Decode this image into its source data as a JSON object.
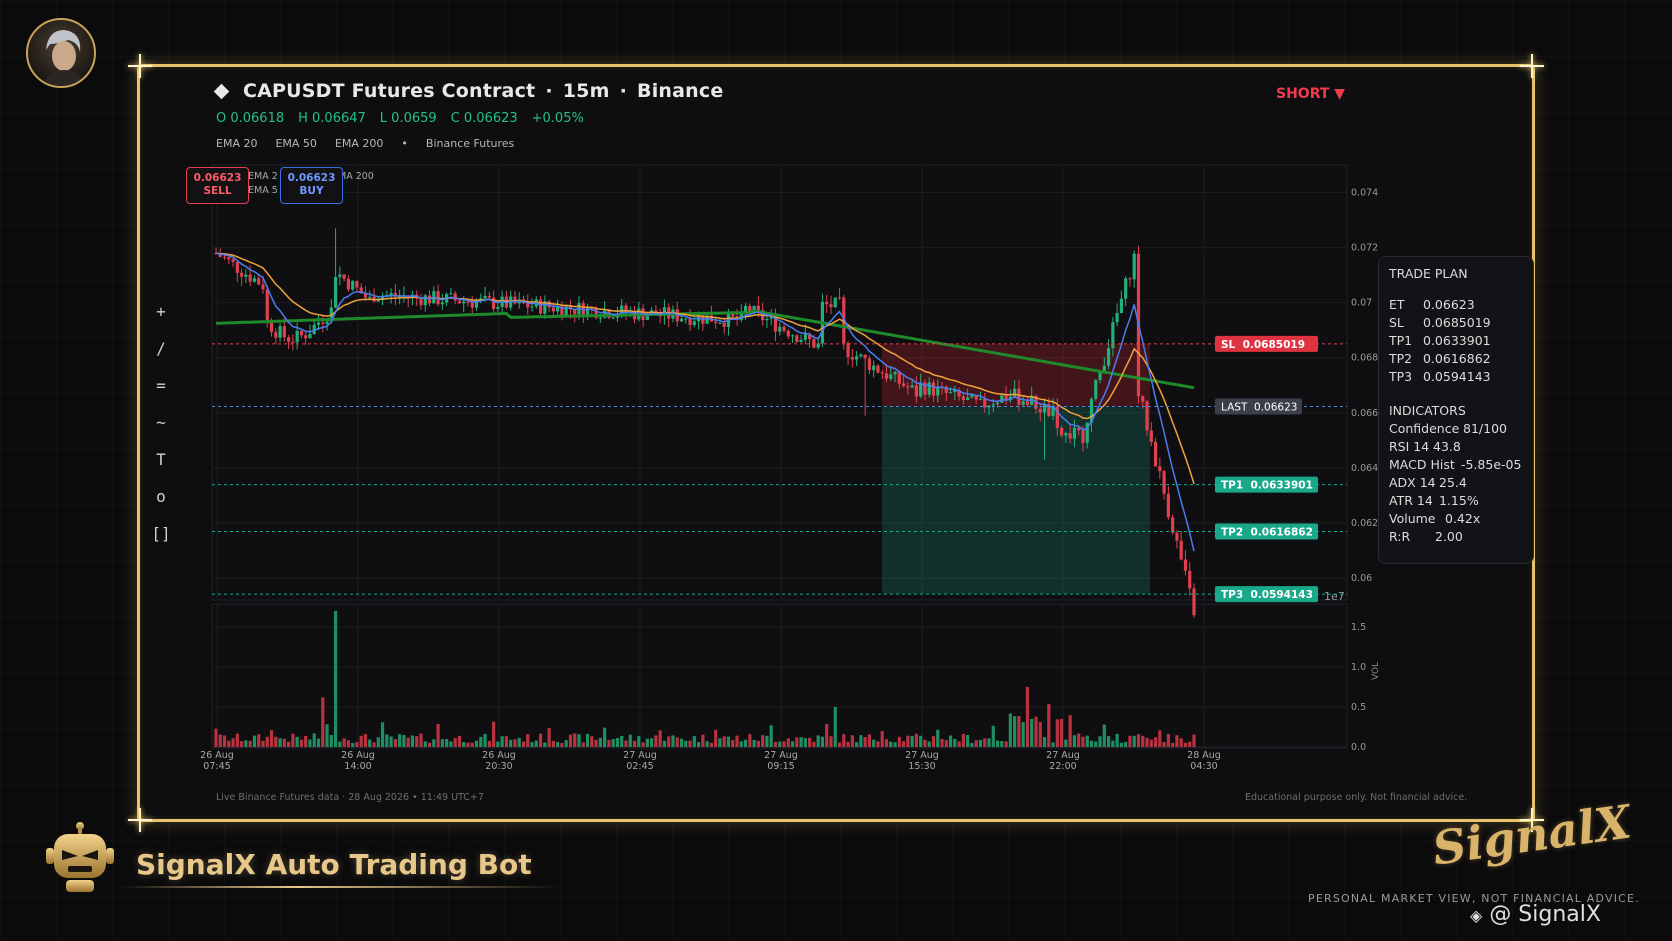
{
  "header": {
    "symbol": "CAPUSDT Futures Contract",
    "interval": "15m",
    "exchange": "Binance",
    "direction": "SHORT ▼",
    "ohlc": {
      "open": "O 0.06618",
      "high": "H 0.06647",
      "low": "L 0.0659",
      "close": "C 0.06623",
      "change": "+0.05%"
    },
    "ema_legend": [
      "EMA 20",
      "EMA 50",
      "EMA 200",
      "•",
      "Binance Futures"
    ]
  },
  "quick_trade": {
    "sell_price": "0.06623",
    "sell_label": "SELL",
    "buy_price": "0.06623",
    "buy_label": "BUY",
    "mini_legend": [
      "EMA 2",
      "EMA 5",
      "MA 200"
    ]
  },
  "tools": [
    "+",
    "/",
    "=",
    "~",
    "T",
    "o",
    "[]"
  ],
  "trade_plan": {
    "title": "TRADE PLAN",
    "rows": [
      {
        "label": "ET",
        "value": "0.06623"
      },
      {
        "label": "SL",
        "value": "0.0685019"
      },
      {
        "label": "TP1",
        "value": "0.0633901"
      },
      {
        "label": "TP2",
        "value": "0.0616862"
      },
      {
        "label": "TP3",
        "value": "0.0594143"
      }
    ],
    "indicators_title": "INDICATORS",
    "indicators": [
      {
        "label": "Confidence",
        "value": "81/100"
      },
      {
        "label": "RSI 14",
        "value": "43.8"
      },
      {
        "label": "MACD Hist",
        "value": "-5.85e-05"
      },
      {
        "label": "ADX 14",
        "value": "25.4"
      },
      {
        "label": "ATR 14",
        "value": "1.15%"
      },
      {
        "label": "Volume",
        "value": "0.42x"
      },
      {
        "label": "R:R",
        "value": "2.00"
      }
    ]
  },
  "chart_data": {
    "type": "candlestick",
    "y_ticks": [
      "0.074",
      "0.072",
      "0.07",
      "0.068",
      "0.066",
      "0.064",
      "0.062",
      "0.06"
    ],
    "y_range": [
      0.0592,
      0.075
    ],
    "y_exponent_label": "1e7",
    "volume_ticks": [
      "1.5",
      "1.0",
      "0.5",
      "0.0"
    ],
    "volume_axis_label": "VOL",
    "x_labels": [
      [
        "26 Aug",
        "07:45"
      ],
      [
        "26 Aug",
        "14:00"
      ],
      [
        "26 Aug",
        "20:30"
      ],
      [
        "27 Aug",
        "02:45"
      ],
      [
        "27 Aug",
        "09:15"
      ],
      [
        "27 Aug",
        "15:30"
      ],
      [
        "27 Aug",
        "22:00"
      ],
      [
        "28 Aug",
        "04:30"
      ]
    ],
    "levels": [
      {
        "name": "SL",
        "label": "SL  0.0685019",
        "price": 0.0685019,
        "color": "#e03342"
      },
      {
        "name": "LAST",
        "label": "LAST  0.06623",
        "price": 0.06623,
        "color": "#3a3f4a"
      },
      {
        "name": "TP1",
        "label": "TP1  0.0633901",
        "price": 0.0633901,
        "color": "#1aa88a"
      },
      {
        "name": "TP2",
        "label": "TP2  0.0616862",
        "price": 0.0616862,
        "color": "#1aa88a"
      },
      {
        "name": "TP3",
        "label": "TP3  0.0594143",
        "price": 0.0594143,
        "color": "#1aa88a"
      }
    ],
    "series": [
      {
        "name": "EMA 20",
        "color": "#4a7cf0"
      },
      {
        "name": "EMA 50",
        "color": "#f0a23a"
      },
      {
        "name": "EMA 200",
        "color": "#1f8a2a"
      }
    ]
  },
  "footer": {
    "source": "Live Binance Futures data  ·  28 Aug 2026 • 11:49 UTC+7",
    "disclaimer": "Educational purpose only. Not financial advice."
  },
  "branding": {
    "bot_title": "SignalX Auto Trading Bot",
    "logo_text": "SignalX",
    "tagline": "PERSONAL MARKET VIEW, NOT FINANCIAL ADVICE.",
    "handle": "@ SignalX"
  }
}
